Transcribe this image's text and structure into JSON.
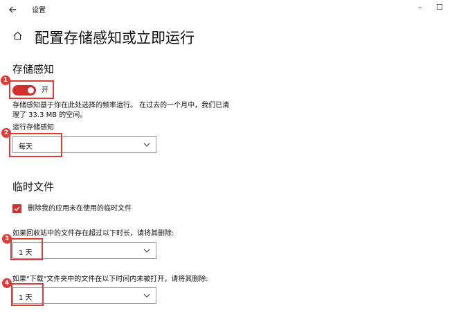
{
  "window": {
    "title": "设置",
    "back_icon": "arrow-left-icon",
    "minimize_glyph": "–",
    "maximize_glyph": "☐"
  },
  "page": {
    "home_icon": "home-icon",
    "title": "配置存储感知或立即运行"
  },
  "storage_sense": {
    "section_title": "存储感知",
    "toggle_state_label": "开",
    "toggle_on": true,
    "description_line1": "存储感知基于你在此处选择的频率运行。 在过去的一个月中，我们已清",
    "description_line2": "理了 33.3 MB 的空间。",
    "run_label": "运行存储感知",
    "run_selected": "每天"
  },
  "temp_files": {
    "section_title": "临时文件",
    "checkbox_label": "删除我的应用未在使用的临时文件",
    "checkbox_checked": true,
    "recycle_label": "如果回收站中的文件存在超过以下时长，请将其删除:",
    "recycle_selected": "1 天",
    "downloads_label": "如果\"下载\"文件夹中的文件在以下时间内未被打开，请将其删除:",
    "downloads_selected": "1 天"
  },
  "annotations": {
    "markers": [
      "1",
      "2",
      "3",
      "4"
    ],
    "highlight_color": "#e03a3a"
  },
  "colors": {
    "accent": "#d32f2f",
    "border": "#9a9a9a"
  }
}
